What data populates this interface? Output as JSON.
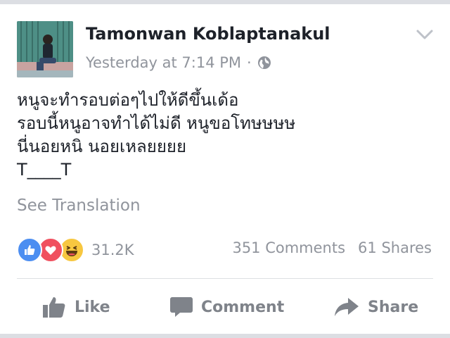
{
  "post": {
    "author": "Tamonwan Koblaptanakul",
    "timestamp": "Yesterday at 7:14 PM",
    "separator": "·",
    "privacy_icon": "globe-icon",
    "menu_icon": "chevron-down-icon",
    "text_lines": [
      "หนูจะทำรอบต่อๆไปให้ดีขึ้นเด้อ",
      "รอบนี้หนูอาจทำได้ไม่ดี หนูขอโทษษษษ",
      "นี่นอยหนิ นอยเหลยยยย",
      "T____T"
    ],
    "see_translation": "See Translation"
  },
  "engagement": {
    "reaction_icons": [
      "like-reaction-icon",
      "love-reaction-icon",
      "haha-reaction-icon"
    ],
    "reaction_count": "31.2K",
    "comments": "351 Comments",
    "shares": "61 Shares"
  },
  "actions": {
    "like": "Like",
    "comment": "Comment",
    "share": "Share"
  },
  "colors": {
    "author_text": "#1d2129",
    "meta_text": "#90949c",
    "like_blue": "#4c8ef1",
    "love_red": "#f0505f",
    "haha_yellow": "#f7c740",
    "action_gray": "#7f838a"
  }
}
